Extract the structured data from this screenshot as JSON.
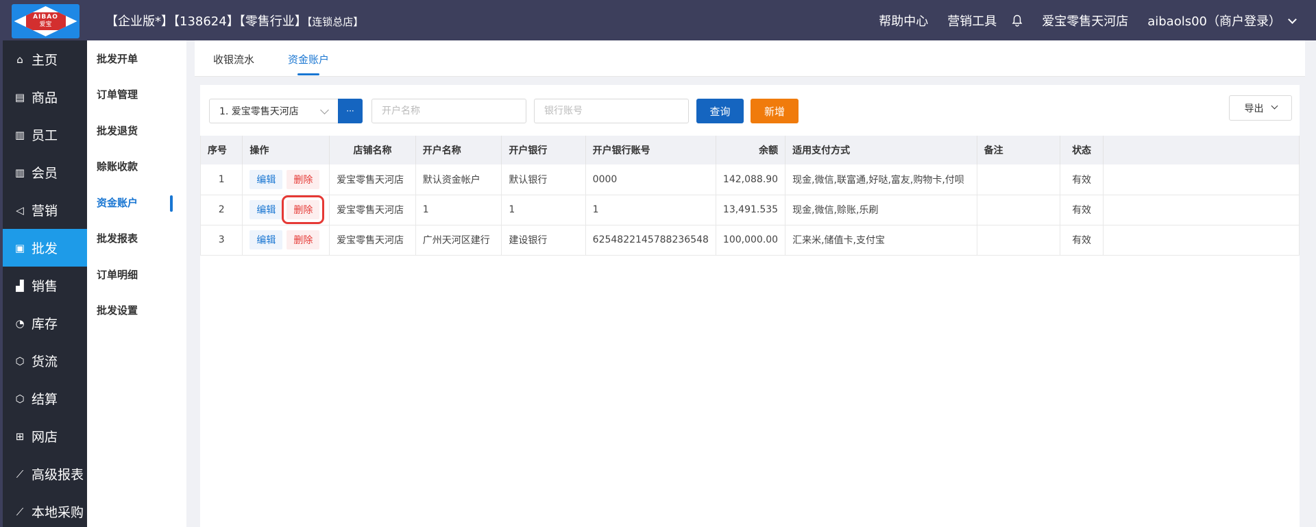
{
  "header": {
    "logo_line1": "AIBAO",
    "logo_line2": "爱宝",
    "title": "【企业版*】【138624】【零售行业】",
    "title_small": "【连锁总店】",
    "help": "帮助中心",
    "marketing_tools": "营销工具",
    "store": "爱宝零售天河店",
    "user": "aibaols00（商户登录）"
  },
  "sidebar": {
    "items": [
      {
        "label": "主页",
        "icon": "home-icon"
      },
      {
        "label": "商品",
        "icon": "product-icon"
      },
      {
        "label": "员工",
        "icon": "employee-icon"
      },
      {
        "label": "会员",
        "icon": "member-icon"
      },
      {
        "label": "营销",
        "icon": "megaphone-icon"
      },
      {
        "label": "批发",
        "icon": "wholesale-icon",
        "active": true
      },
      {
        "label": "销售",
        "icon": "chart-icon"
      },
      {
        "label": "库存",
        "icon": "pie-icon"
      },
      {
        "label": "货流",
        "icon": "cube-icon"
      },
      {
        "label": "结算",
        "icon": "cube-icon"
      },
      {
        "label": "网店",
        "icon": "gift-icon"
      },
      {
        "label": "高级报表",
        "icon": "line-chart-icon"
      },
      {
        "label": "本地采购",
        "icon": "line-chart-icon"
      }
    ]
  },
  "subnav": {
    "items": [
      "批发开单",
      "订单管理",
      "批发退货",
      "赊账收款",
      "资金账户",
      "批发报表",
      "订单明细",
      "批发设置"
    ],
    "active_index": 4
  },
  "tabs": [
    "收银流水",
    "资金账户"
  ],
  "filters": {
    "store_value": "1. 爱宝零售天河店",
    "more_label": "···",
    "account_name_placeholder": "开户名称",
    "bank_account_placeholder": "银行账号",
    "query_label": "查询",
    "add_label": "新增",
    "export_label": "导出"
  },
  "table": {
    "columns": [
      "序号",
      "操作",
      "店铺名称",
      "开户名称",
      "开户银行",
      "开户银行账号",
      "余额",
      "适用支付方式",
      "备注",
      "状态"
    ],
    "edit_label": "编辑",
    "delete_label": "删除",
    "rows": [
      {
        "no": "1",
        "store": "爱宝零售天河店",
        "account_name": "默认资金帐户",
        "bank": "默认银行",
        "bank_account": "0000",
        "balance": "142,088.90",
        "payment": "现金,微信,联富通,好哒,富友,购物卡,付呗",
        "remark": "",
        "status": "有效"
      },
      {
        "no": "2",
        "store": "爱宝零售天河店",
        "account_name": "1",
        "bank": "1",
        "bank_account": "1",
        "balance": "13,491.535",
        "payment": "现金,微信,赊账,乐刷",
        "remark": "",
        "status": "有效"
      },
      {
        "no": "3",
        "store": "爱宝零售天河店",
        "account_name": "广州天河区建行",
        "bank": "建设银行",
        "bank_account": "6254822145788236548",
        "balance": "100,000.00",
        "payment": "汇来米,储值卡,支付宝",
        "remark": "",
        "status": "有效"
      }
    ]
  }
}
